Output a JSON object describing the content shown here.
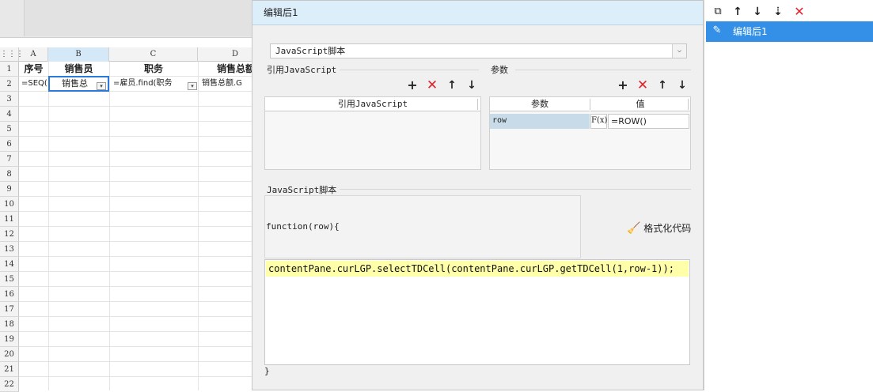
{
  "sheet": {
    "columns": [
      "A",
      "B",
      "C",
      "D"
    ],
    "rows": [
      "1",
      "2",
      "3",
      "4",
      "5",
      "6",
      "7",
      "8",
      "9",
      "10",
      "11",
      "12",
      "13",
      "14",
      "15",
      "16",
      "17",
      "18",
      "19",
      "20",
      "21",
      "22"
    ],
    "header_row": [
      "序号",
      "销售员",
      "职务",
      "销售总额"
    ],
    "formula_row": [
      "=SEQ(",
      "销售总",
      "=雇员.find(职务",
      "销售总额.G"
    ]
  },
  "dialog": {
    "title": "编辑后1",
    "type_select": "JavaScript脚本",
    "ref_js": {
      "label": "引用JavaScript",
      "col_header": "引用JavaScript"
    },
    "params": {
      "label": "参数",
      "col_param": "参数",
      "col_value": "值",
      "rows": [
        {
          "name": "row",
          "fx": "F(x)",
          "value": "=ROW()"
        }
      ]
    },
    "script": {
      "label": "JavaScript脚本",
      "function_header": "function(row){",
      "format_button": "格式化代码",
      "code_line": "contentPane.curLGP.selectTDCell(contentPane.curLGP.getTDCell(1,row-1));",
      "closing": "}"
    }
  },
  "right_panel": {
    "items": [
      "编辑后1"
    ]
  },
  "colors": {
    "accent": "#3390e6",
    "delete_red": "#e0232b",
    "code_highlight": "#ffffaa",
    "title_bar": "#dbeefa"
  }
}
